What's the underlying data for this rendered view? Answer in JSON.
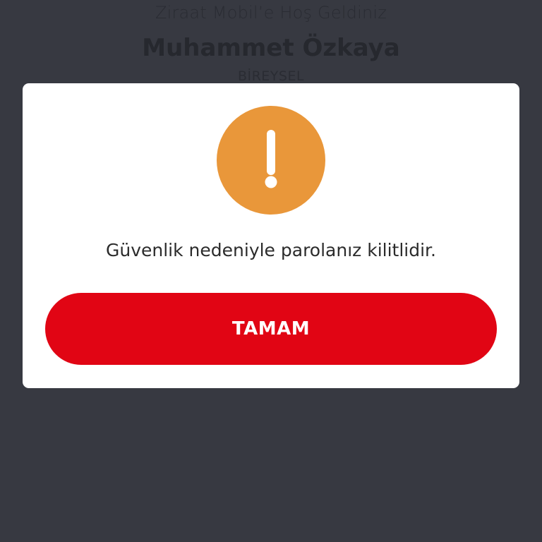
{
  "background": {
    "welcome": "Ziraat Mobil’e Hoş Geldiniz",
    "user_name": "Muhammet Özkaya",
    "account_type": "BİREYSEL"
  },
  "dialog": {
    "icon": "exclamation-icon",
    "message": "Güvenlik nedeniyle parolanız kilitlidir.",
    "ok_label": "TAMAM"
  },
  "colors": {
    "overlay": "#373941",
    "dialog_background": "#ffffff",
    "warning": "#e9973a",
    "primary_button": "#e10514"
  }
}
